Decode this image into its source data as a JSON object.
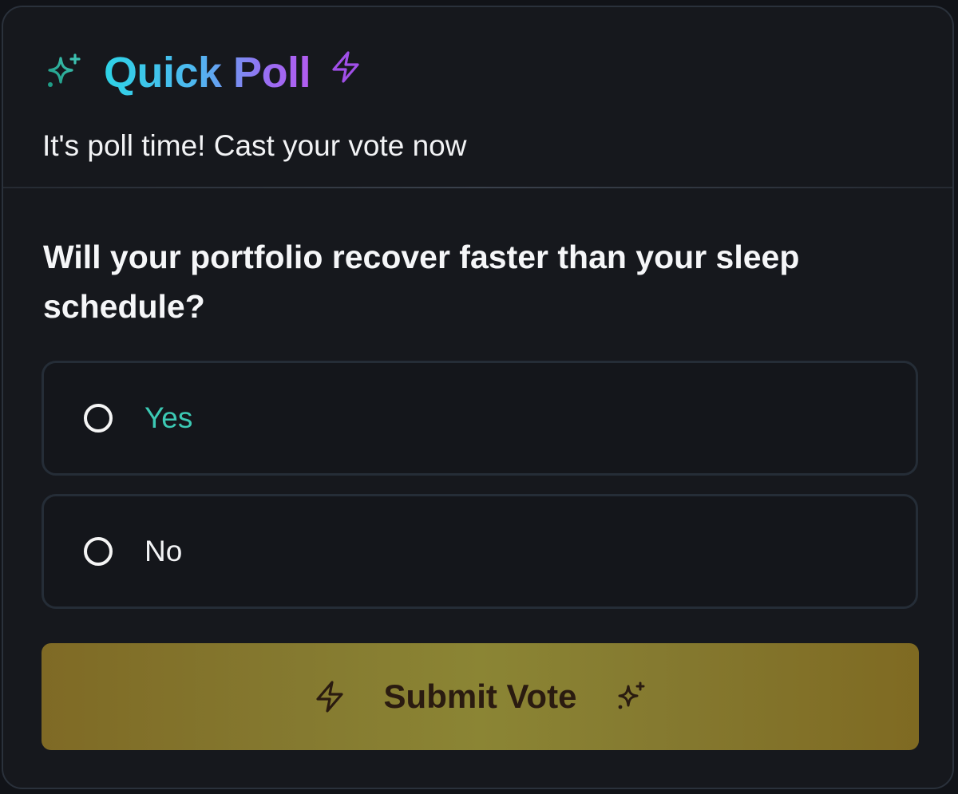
{
  "poll": {
    "title": "Quick Poll",
    "subtitle": "It's poll time! Cast your vote now",
    "question": "Will your portfolio recover faster than your sleep schedule?",
    "options": [
      {
        "label": "Yes",
        "selected": false,
        "color": "#3cc9b4"
      },
      {
        "label": "No",
        "selected": false,
        "color": "#f2f3f5"
      }
    ],
    "submit_label": "Submit Vote"
  },
  "icons": {
    "title_left": "sparkles-icon",
    "title_right": "lightning-bolt-icon",
    "submit_left": "lightning-bolt-icon",
    "submit_right": "sparkles-icon"
  },
  "colors": {
    "background": "#16181d",
    "border": "#2a313b",
    "title_gradient_start": "#2ed3e6",
    "title_gradient_end": "#b25cf0",
    "accent_teal": "#3cc9b4",
    "submit_background": "#857a30",
    "submit_text": "#2a1b10"
  }
}
